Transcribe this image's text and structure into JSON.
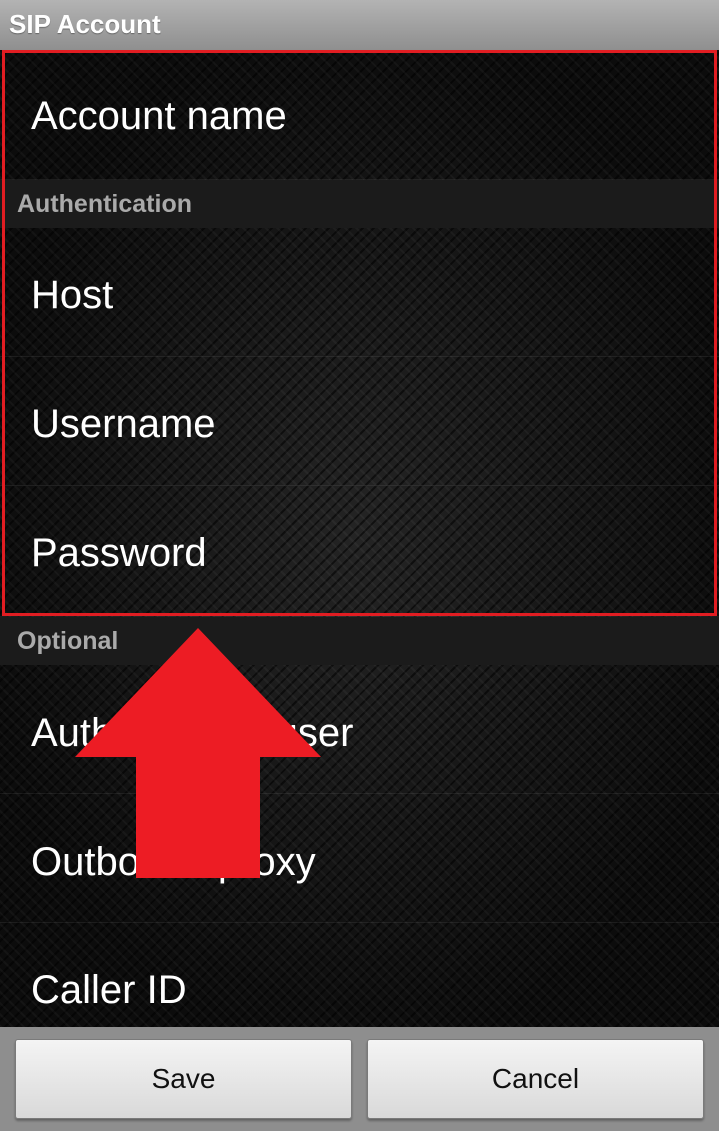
{
  "window": {
    "title": "SIP Account"
  },
  "rows": {
    "account_name": "Account name",
    "host": "Host",
    "username": "Username",
    "password": "Password",
    "authorization_user": "Authorization user",
    "outbound_proxy": "Outbound proxy",
    "caller_id": "Caller ID"
  },
  "sections": {
    "authentication": "Authentication",
    "optional": "Optional"
  },
  "buttons": {
    "save": "Save",
    "cancel": "Cancel"
  },
  "colors": {
    "highlight": "#e11d22",
    "arrow": "#ed1c24"
  },
  "annotations": [
    "red-rectangle-highlight",
    "red-up-arrow"
  ]
}
